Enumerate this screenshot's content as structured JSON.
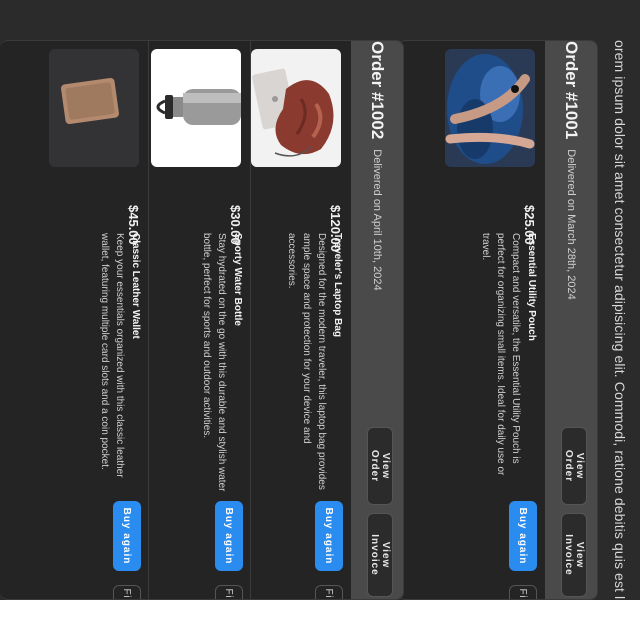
{
  "intro_text": "orem ipsum dolor sit amet consectetur adipisicing elit. Commodi, ratione debitis quis est labore voluptatibus!",
  "orders": [
    {
      "title": "Order #1001",
      "date": "Delivered on March 28th, 2024",
      "view_order_label": "View Order",
      "view_invoice_label": "View Invoice",
      "items": [
        {
          "name": "Essential Utility Pouch",
          "description": "Compact and versatile, the Essential Utility Pouch is perfect for organizing small items. Ideal for daily use or travel.",
          "price": "$25.00",
          "buy_again_label": "Buy again",
          "find_similar_label": "Find similar"
        }
      ]
    },
    {
      "title": "Order #1002",
      "date": "Delivered on April 10th, 2024",
      "view_order_label": "View Order",
      "view_invoice_label": "View Invoice",
      "items": [
        {
          "name": "Traveler's Laptop Bag",
          "description": "Designed for the modern traveler, this laptop bag provides ample space and protection for your device and accessories.",
          "price": "$120.00",
          "buy_again_label": "Buy again",
          "find_similar_label": "Find similar"
        },
        {
          "name": "Sporty Water Bottle",
          "description": "Stay hydrated on the go with this durable and stylish water bottle, perfect for sports and outdoor activities.",
          "price": "$30.00",
          "buy_again_label": "Buy again",
          "find_similar_label": "Find similar"
        },
        {
          "name": "Classic Leather Wallet",
          "description": "Keep your essentials organized with this classic leather wallet, featuring multiple card slots and a coin pocket.",
          "price": "$45.00",
          "buy_again_label": "Buy again",
          "find_similar_label": "Find similar"
        }
      ]
    }
  ],
  "colors": {
    "page_bg": "#2b2b2b",
    "header_bg": "#4a4a4a",
    "primary_button": "#2b8cf0"
  }
}
